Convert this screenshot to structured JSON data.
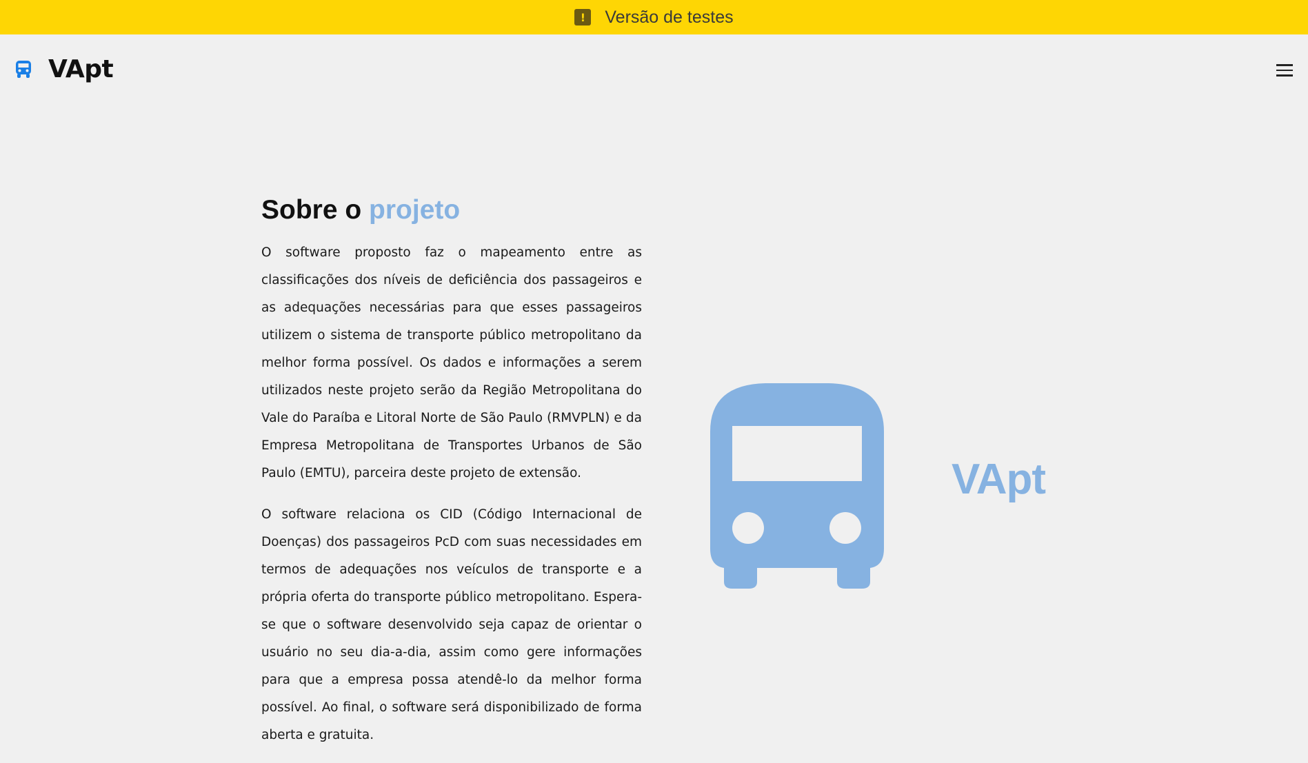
{
  "banner": {
    "icon": "exclamation-icon",
    "text": "Versão de testes"
  },
  "header": {
    "logo_icon": "bus-icon",
    "app_name": "VApt",
    "menu_icon": "hamburger-menu-icon"
  },
  "main": {
    "title_part1": "Sobre o ",
    "title_part2": "projeto",
    "paragraphs": [
      "O software proposto faz o mapeamento entre as classificações dos níveis de deficiência dos passageiros e as adequações necessárias para que esses passageiros utilizem o sistema de transporte público metropolitano da melhor forma possível. Os dados e informações a serem utilizados neste projeto serão da Região Metropolitana do Vale do Paraíba e Litoral Norte de São Paulo (RMVPLN) e da Empresa Metropolitana de Transportes Urbanos de São Paulo (EMTU), parceira deste projeto de extensão.",
      "O software relaciona os CID (Código Internacional de Doenças) dos passageiros PcD com suas necessidades em termos de adequações nos veículos de transporte e a própria oferta do transporte público metropolitano. Espera-se que o software desenvolvido seja capaz de orientar o usuário no seu dia-a-dia, assim como gere informações para que a empresa possa atendê-lo da melhor forma possível. Ao final, o software será disponibilizado de forma aberta e gratuita."
    ]
  },
  "hero": {
    "icon": "bus-icon",
    "name": "VApt"
  },
  "colors": {
    "banner_bg": "#fed604",
    "accent": "#86b2e1",
    "logo_blue": "#1a7fe6",
    "page_bg": "#f0f0f0"
  }
}
